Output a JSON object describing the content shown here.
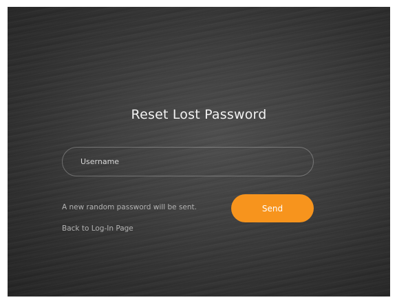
{
  "form": {
    "title": "Reset Lost Password",
    "username_placeholder": "Username",
    "username_value": "",
    "hint": "A new random password will be sent.",
    "send_label": "Send",
    "back_link": "Back to Log-In Page"
  },
  "colors": {
    "accent": "#f7941d",
    "background": "#3a3a3a"
  }
}
